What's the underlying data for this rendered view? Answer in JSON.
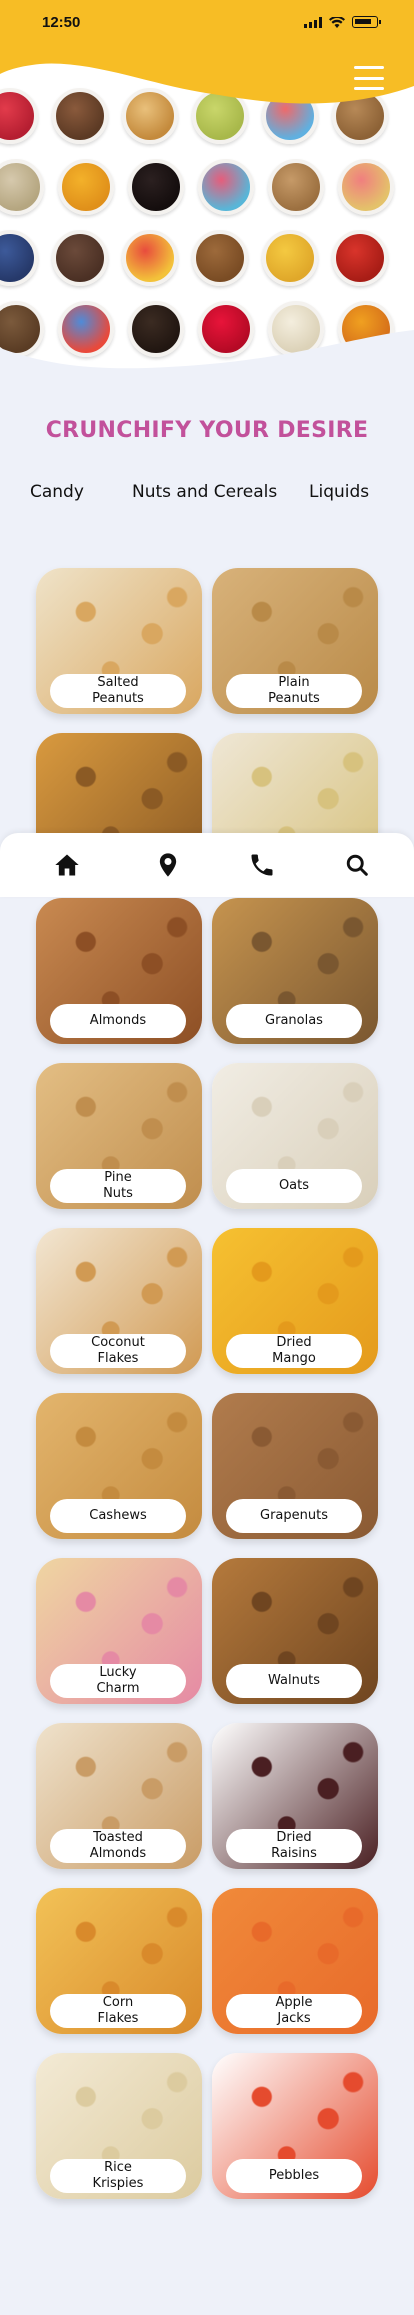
{
  "status_bar": {
    "time": "12:50"
  },
  "header": {
    "accent_color": "#f7bd25",
    "menu_icon": "hamburger-menu-icon"
  },
  "title": "CRUNCHIFY YOUR DESIRE",
  "title_color": "#c2519b",
  "categories": [
    "Candy",
    "Nuts and Cereals",
    "Liquids"
  ],
  "products": [
    {
      "label": "Salted\nPeanuts",
      "colors": [
        "#efe3c9",
        "#d9a760"
      ]
    },
    {
      "label": "Plain\nPeanuts",
      "colors": [
        "#d8b27a",
        "#b98a48"
      ]
    },
    {
      "label": "",
      "colors": [
        "#d99a3f",
        "#8b5a24"
      ]
    },
    {
      "label": "",
      "colors": [
        "#efe7d6",
        "#d7c27e"
      ]
    },
    {
      "label": "Almonds",
      "colors": [
        "#c98a51",
        "#8d4f25"
      ]
    },
    {
      "label": "Granolas",
      "colors": [
        "#c6944f",
        "#7a5730"
      ]
    },
    {
      "label": "Pine\nNuts",
      "colors": [
        "#e3be84",
        "#c08e4e"
      ]
    },
    {
      "label": "Oats",
      "colors": [
        "#f1ede4",
        "#d9cfba"
      ]
    },
    {
      "label": "Coconut\nFlakes",
      "colors": [
        "#f2e6d2",
        "#d19a53"
      ]
    },
    {
      "label": "Dried\nMango",
      "colors": [
        "#f6c131",
        "#e49a1c"
      ]
    },
    {
      "label": "Cashews",
      "colors": [
        "#e3b56d",
        "#c48b3f"
      ]
    },
    {
      "label": "Grapenuts",
      "colors": [
        "#b17c4d",
        "#8a5a33"
      ]
    },
    {
      "label": "Lucky\nCharm",
      "colors": [
        "#efd6a2",
        "#e58aa4"
      ]
    },
    {
      "label": "Walnuts",
      "colors": [
        "#b57a3c",
        "#6f4520"
      ]
    },
    {
      "label": "Toasted\nAlmonds",
      "colors": [
        "#efe2cc",
        "#c99c66"
      ]
    },
    {
      "label": "Dried\nRaisins",
      "colors": [
        "#ffffff",
        "#4a1f22"
      ]
    },
    {
      "label": "Corn\nFlakes",
      "colors": [
        "#f2c257",
        "#d98a2b"
      ]
    },
    {
      "label": "Apple\nJacks",
      "colors": [
        "#f08a3a",
        "#e86a2a"
      ]
    },
    {
      "label": "Rice\nKrispies",
      "colors": [
        "#f3ead5",
        "#dccb9f"
      ]
    },
    {
      "label": "Pebbles",
      "colors": [
        "#ffffff",
        "#e54b2e"
      ]
    }
  ],
  "tabbar": [
    {
      "name": "home-icon"
    },
    {
      "name": "location-pin-icon"
    },
    {
      "name": "phone-icon"
    },
    {
      "name": "search-icon"
    }
  ]
}
